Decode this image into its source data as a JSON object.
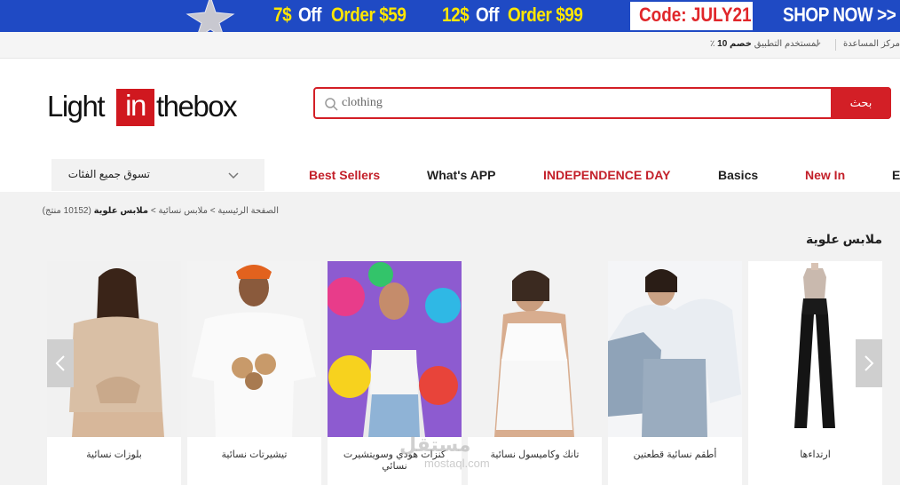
{
  "promo": {
    "deal1_amount": "7$",
    "deal1_off": "Off",
    "deal1_order": "Order $59",
    "deal2_amount": "12$",
    "deal2_off": "Off",
    "deal2_order": "Order $99",
    "code": "Code: JULY21",
    "cta": "SHOP NOW >>"
  },
  "util": {
    "help": "مركز المساعدة",
    "app_bold": "خصم 10",
    "app_text": "٪ لمستخدم التطبيق"
  },
  "logo": {
    "part1": "Light",
    "part2": "in",
    "part3": "thebox"
  },
  "search": {
    "value": "clothing",
    "button": "بحث"
  },
  "nav": {
    "categories": "تسوق جميع الفئات",
    "items": [
      {
        "label": "Best Sellers",
        "color": "#c3202a"
      },
      {
        "label": "What's APP",
        "color": "#222222"
      },
      {
        "label": "INDEPENDENCE DAY",
        "color": "#c3202a"
      },
      {
        "label": "Basics",
        "color": "#222222"
      },
      {
        "label": "New In",
        "color": "#c3202a"
      },
      {
        "label": "E",
        "color": "#222222"
      }
    ]
  },
  "breadcrumb": {
    "home": "الصفحة الرئيسية",
    "sep": ">",
    "level2": "ملابس نسائية",
    "current": "ملابس علوية",
    "count": "(10152 منتج)"
  },
  "section_title": "ملابس علوية",
  "products": [
    {
      "caption": "ارتداءها",
      "icon": "jumpsuit-image"
    },
    {
      "caption": "أطقم نسائية قطعتين",
      "icon": "hoodie-set-image"
    },
    {
      "caption": "تانك وكاميسول نسائية",
      "icon": "camisole-image"
    },
    {
      "caption": "كنزات هودي وسويتشيرت نسائي",
      "icon": "tie-dye-hoodie-image"
    },
    {
      "caption": "تيشيرتات نسائية",
      "icon": "tshirt-image"
    },
    {
      "caption": "بلوزات نسائية",
      "icon": "blouse-image"
    }
  ],
  "watermark": {
    "ar": "مستقل",
    "en": "mostaql.com"
  }
}
